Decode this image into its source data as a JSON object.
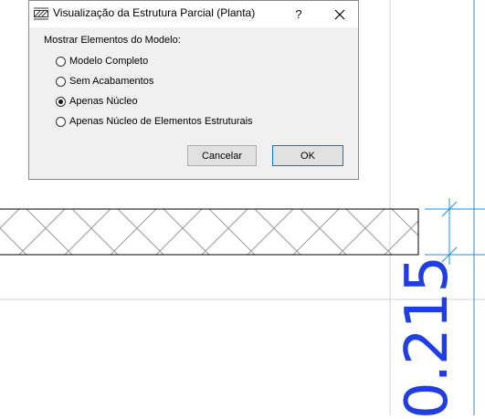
{
  "dialog": {
    "title": "Visualização da Estrutura Parcial (Planta)",
    "help_label": "?",
    "group_label": "Mostrar Elementos do Modelo:",
    "options": [
      {
        "label": "Modelo Completo",
        "checked": false
      },
      {
        "label": "Sem Acabamentos",
        "checked": false
      },
      {
        "label": "Apenas Núcleo",
        "checked": true
      },
      {
        "label": "Apenas Núcleo de Elementos Estruturais",
        "checked": false
      }
    ],
    "cancel_label": "Cancelar",
    "ok_label": "OK"
  },
  "canvas": {
    "dimension_value": "0.215",
    "dimension_color": "#1f3fe0",
    "wall_hatch": "crosshatch"
  },
  "icons": {
    "title": "structure-hatch-icon",
    "close": "close-icon"
  }
}
